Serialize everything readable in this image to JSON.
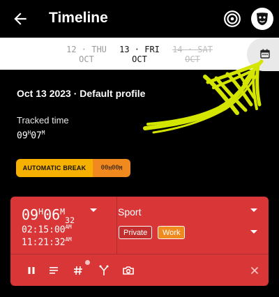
{
  "header": {
    "title": "Timeline",
    "back_icon": "arrow-left-icon",
    "target_icon": "target-icon",
    "profile_icon": "theater-mask-icon"
  },
  "date_strip": {
    "prev": {
      "day": "12 · THU",
      "month": "OCT"
    },
    "current": {
      "day": "13 · FRI",
      "month": "OCT"
    },
    "next": {
      "day": "14 · SAT",
      "month": "OCT"
    },
    "calendar_icon": "calendar-icon"
  },
  "summary": {
    "date_profile": "Oct 13 2023 · Default profile",
    "tracked_label": "Tracked time",
    "tracked_h": "09",
    "tracked_m": "07"
  },
  "break_badge": {
    "label": "AUTOMATIC BREAK",
    "value_h": "00",
    "value_m": "00"
  },
  "entry": {
    "duration_h": "09",
    "duration_m": "06",
    "duration_s": "32",
    "start_time": "02:15:00",
    "start_ampm": "AM",
    "end_time": "11:21:32",
    "end_ampm": "AM",
    "activity": "Sport",
    "tags": [
      "Private",
      "Work"
    ],
    "actions": [
      "pause-icon",
      "notes-icon",
      "hashtag-icon",
      "fork-icon",
      "camera-icon",
      "close-icon"
    ]
  },
  "colors": {
    "card": "#d93737",
    "break_label": "#f6b000",
    "break_value": "#f08a1e",
    "arrow": "#d4e600"
  }
}
